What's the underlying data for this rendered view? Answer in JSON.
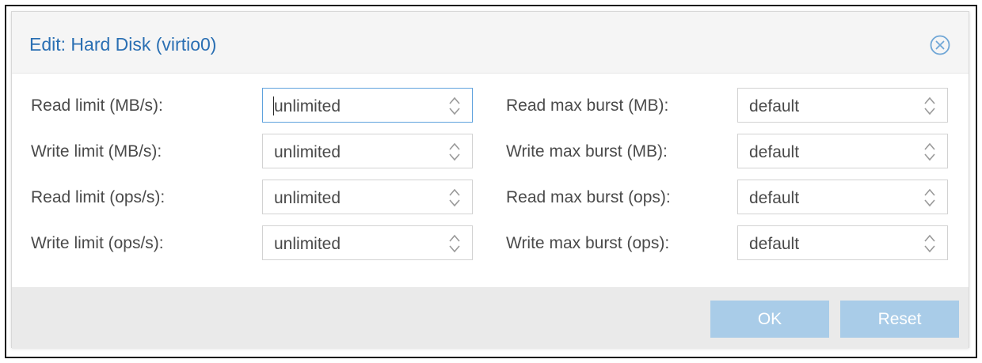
{
  "dialog": {
    "title": "Edit: Hard Disk (virtio0)"
  },
  "fields_left": [
    {
      "label": "Read limit (MB/s):",
      "value": "unlimited",
      "focused": true
    },
    {
      "label": "Write limit (MB/s):",
      "value": "unlimited",
      "focused": false
    },
    {
      "label": "Read limit (ops/s):",
      "value": "unlimited",
      "focused": false
    },
    {
      "label": "Write limit (ops/s):",
      "value": "unlimited",
      "focused": false
    }
  ],
  "fields_right": [
    {
      "label": "Read max burst (MB):",
      "value": "default"
    },
    {
      "label": "Write max burst (MB):",
      "value": "default"
    },
    {
      "label": "Read max burst (ops):",
      "value": "default"
    },
    {
      "label": "Write max burst (ops):",
      "value": "default"
    }
  ],
  "buttons": {
    "ok_label": "OK",
    "reset_label": "Reset",
    "ok_disabled": true,
    "reset_disabled": true
  },
  "icons": {
    "close": "close-circle-icon",
    "spinner": "spinner-updown-icon"
  },
  "colors": {
    "title": "#2a6fb3",
    "focus_border": "#5fa2dd",
    "button_disabled": "#a9cce8"
  }
}
